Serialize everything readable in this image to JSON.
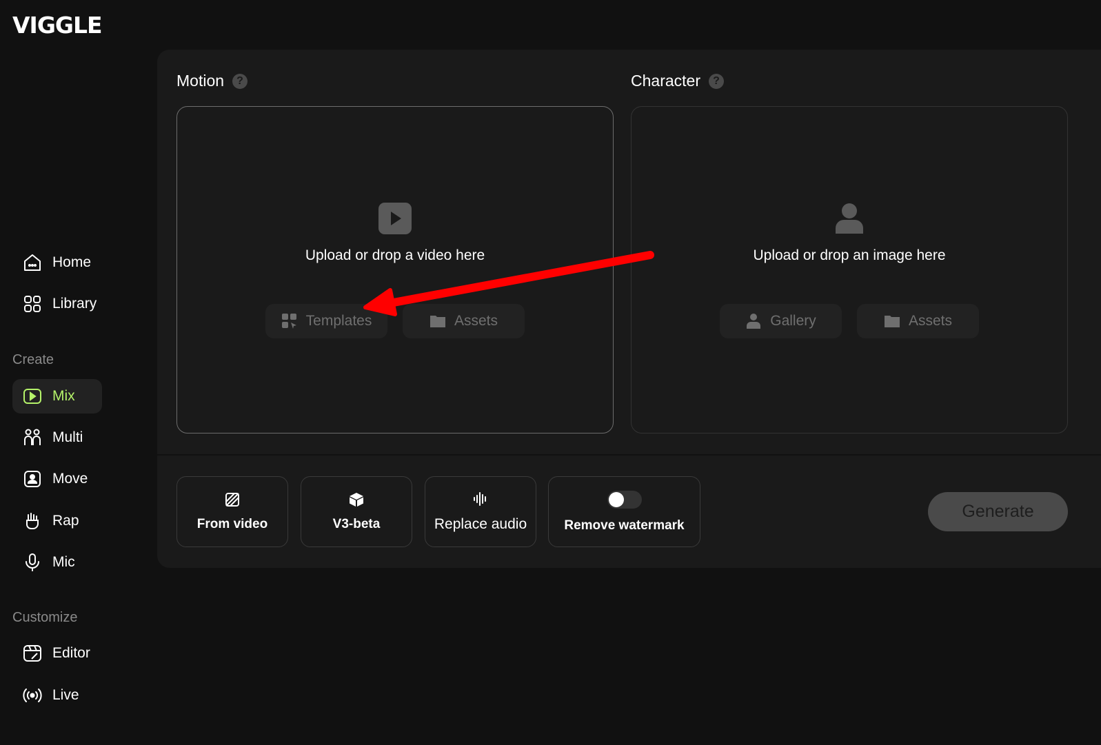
{
  "app": {
    "logo_text": "VIGGLE"
  },
  "sidebar": {
    "items_top": [
      {
        "label": "Home",
        "icon": "home-icon"
      },
      {
        "label": "Library",
        "icon": "library-icon"
      }
    ],
    "create_section": "Create",
    "create_items": [
      {
        "label": "Mix",
        "icon": "mix-icon",
        "active": true
      },
      {
        "label": "Multi",
        "icon": "multi-icon"
      },
      {
        "label": "Move",
        "icon": "move-icon"
      },
      {
        "label": "Rap",
        "icon": "rap-icon"
      },
      {
        "label": "Mic",
        "icon": "mic-icon"
      }
    ],
    "customize_section": "Customize",
    "customize_items": [
      {
        "label": "Editor",
        "icon": "editor-icon"
      },
      {
        "label": "Live",
        "icon": "live-icon"
      }
    ]
  },
  "motion": {
    "title": "Motion",
    "help": "?",
    "upload_text": "Upload or drop a video here",
    "buttons": [
      {
        "label": "Templates",
        "icon": "templates-icon"
      },
      {
        "label": "Assets",
        "icon": "folder-icon"
      }
    ]
  },
  "character": {
    "title": "Character",
    "help": "?",
    "upload_text": "Upload or drop an image here",
    "buttons": [
      {
        "label": "Gallery",
        "icon": "person-icon"
      },
      {
        "label": "Assets",
        "icon": "folder-icon"
      }
    ]
  },
  "options": {
    "from_video": "From video",
    "v3_beta": "V3-beta",
    "replace_audio": "Replace audio",
    "remove_watermark": "Remove watermark",
    "remove_watermark_enabled": false
  },
  "generate": {
    "label": "Generate"
  },
  "colors": {
    "accent": "#b5f36a",
    "background": "#111111",
    "panel": "#1a1a1a",
    "annotation_arrow": "#ff0000"
  }
}
